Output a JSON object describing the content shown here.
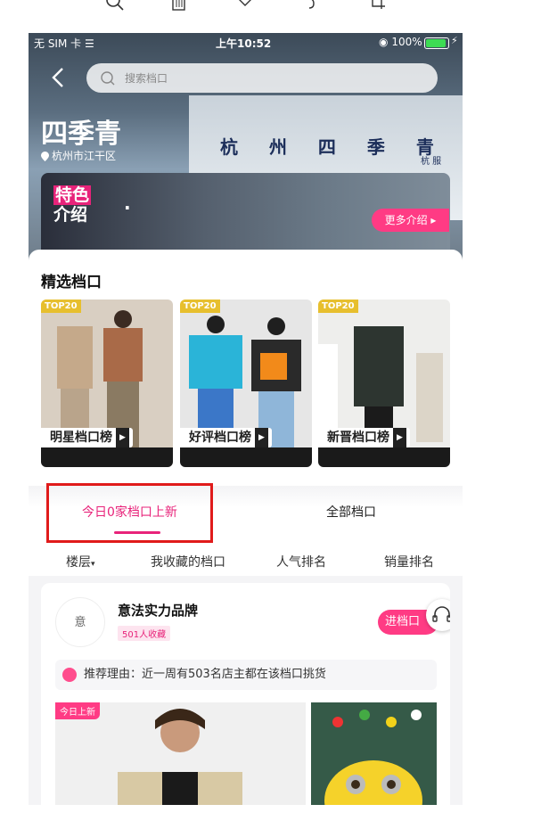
{
  "status_bar": {
    "carrier": "无 SIM 卡",
    "time": "上午10:52",
    "battery": "100%"
  },
  "search": {
    "placeholder": "搜索档口"
  },
  "hero": {
    "store_name": "四季青",
    "location": "杭州市江干区",
    "building_text": "杭 州 四 季 青",
    "building_small": "杭 服"
  },
  "intro": {
    "badge_line1": "特色",
    "badge_line2": "介绍",
    "more_button": "更多介绍"
  },
  "featured": {
    "title": "精选档口",
    "cards": [
      {
        "badge": "TOP20",
        "label": "明星档口榜"
      },
      {
        "badge": "TOP20",
        "label": "好评档口榜"
      },
      {
        "badge": "TOP20",
        "label": "新晋档口榜"
      }
    ]
  },
  "tabs": {
    "new_today": "今日0家档口上新",
    "all": "全部档口"
  },
  "filters": [
    "楼层",
    "我收藏的档口",
    "人气排名",
    "销量排名"
  ],
  "store": {
    "avatar_text": "意",
    "name": "意法实力品牌",
    "favorites": "501人收藏",
    "enter_button": "进档口",
    "reason": "推荐理由：近一周有503名店主都在该档口挑货",
    "new_tag": "今日上新"
  },
  "colors": {
    "accent": "#e8237a",
    "button": "#ff3b84",
    "highlight": "#e01b1b",
    "badge_gold": "#e7bf2e"
  }
}
